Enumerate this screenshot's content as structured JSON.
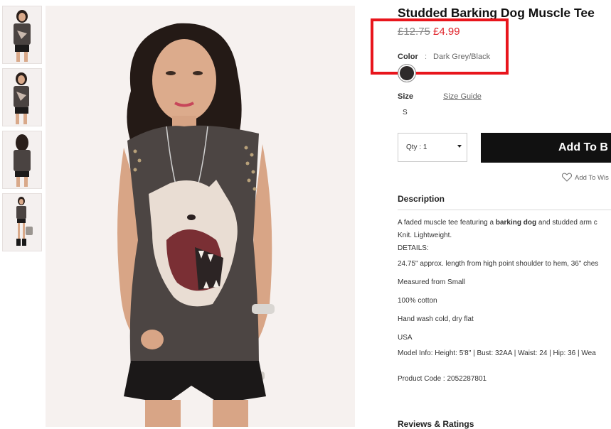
{
  "product": {
    "title": "Studded Barking Dog Muscle Tee",
    "price_old": "£12.75",
    "price_new": "£4.99",
    "color_label": "Color",
    "color_separator": ":",
    "color_value": "Dark Grey/Black",
    "swatch_color": "#2e2a2a",
    "size_label": "Size",
    "size_guide": "Size Guide",
    "size_option": "S",
    "qty_label": "Qty : 1",
    "add_button": "Add To B",
    "wishlist": "Add To Wis"
  },
  "description": {
    "title": "Description",
    "line1_pre": "A faded muscle tee featuring a ",
    "line1_bold": "barking dog",
    "line1_post": " and studded arm c",
    "line2": "Knit. Lightweight.",
    "details_label": "DETAILS:",
    "detail_length": "24.75\" approx. length from high point shoulder to hem, 36\" ches",
    "detail_measured": "Measured from Small",
    "detail_cotton": "100% cotton",
    "detail_wash": "Hand wash cold, dry flat",
    "detail_origin": "USA",
    "detail_model": "Model Info: Height: 5'8\" | Bust: 32AA | Waist: 24 | Hip: 36 | Wea",
    "product_code": "Product Code : 2052287801"
  },
  "reviews": {
    "title": "Reviews & Ratings"
  },
  "colors": {
    "sale": "#e0242b",
    "highlight": "#e8151c",
    "button": "#111111"
  }
}
